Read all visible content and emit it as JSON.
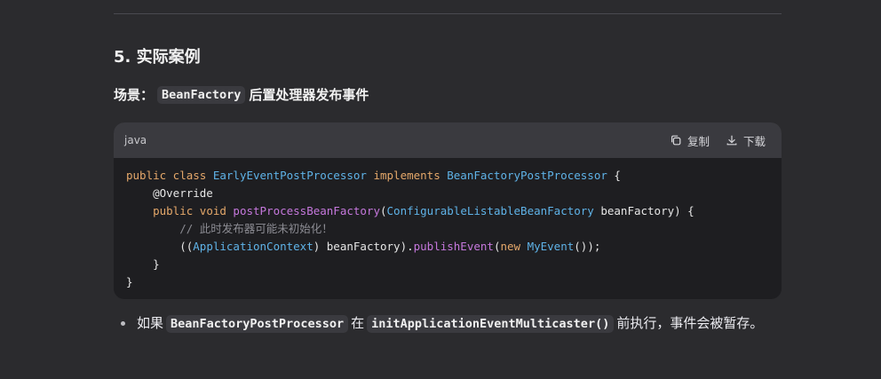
{
  "section": {
    "title": "5. 实际案例",
    "scenario_prefix": "场景：",
    "scenario_code": "BeanFactory",
    "scenario_suffix": " 后置处理器发布事件"
  },
  "code_block": {
    "language": "java",
    "copy_label": "复制",
    "download_label": "下载",
    "lines": {
      "l1_kw1": "public class ",
      "l1_ty1": "EarlyEventPostProcessor",
      "l1_kw2": " implements ",
      "l1_ty2": "BeanFactoryPostProcessor",
      "l1_end": " {",
      "l2": "    @Override",
      "l3_indent": "    ",
      "l3_kw": "public void ",
      "l3_fn": "postProcessBeanFactory",
      "l3_open": "(",
      "l3_ty": "ConfigurableListableBeanFactory",
      "l3_rest": " beanFactory) {",
      "l4": "        // 此时发布器可能未初始化！",
      "l5_a": "        ((",
      "l5_ty": "ApplicationContext",
      "l5_b": ") beanFactory).",
      "l5_fn": "publishEvent",
      "l5_c": "(",
      "l5_kw": "new ",
      "l5_ty2": "MyEvent",
      "l5_d": "());",
      "l6": "    }",
      "l7": "}"
    }
  },
  "bullet": {
    "prefix": "如果",
    "code1": "BeanFactoryPostProcessor",
    "middle": "在",
    "code2": "initApplicationEventMulticaster()",
    "suffix": "前执行，事件会被暂存。"
  }
}
